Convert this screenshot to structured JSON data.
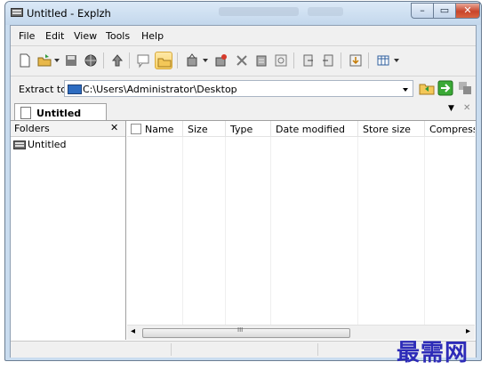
{
  "window": {
    "title": "Untitled - Explzh",
    "minimize": "–",
    "maximize": "▭",
    "close": "✕"
  },
  "menu": {
    "items": [
      {
        "label": "File"
      },
      {
        "label": "Edit"
      },
      {
        "label": "View"
      },
      {
        "label": "Tools"
      },
      {
        "label": "Help"
      }
    ]
  },
  "extract": {
    "label": "Extract to",
    "path": "C:\\Users\\Administrator\\Desktop"
  },
  "tabs": {
    "active": "Untitled",
    "menu_arrow": "▼",
    "close": "✕"
  },
  "folders": {
    "header": "Folders",
    "close": "✕",
    "items": [
      {
        "label": "Untitled"
      }
    ]
  },
  "file_list": {
    "columns": [
      {
        "label": "Name"
      },
      {
        "label": "Size"
      },
      {
        "label": "Type"
      },
      {
        "label": "Date modified"
      },
      {
        "label": "Store size"
      },
      {
        "label": "Compress r"
      }
    ],
    "scroll_grip": "III",
    "scroll_left": "◂",
    "scroll_right": "▸"
  },
  "watermark": "最需网",
  "colors": {
    "active_tool": "#f9d267",
    "close_button": "#c8442a",
    "watermark": "#2d2bb8"
  }
}
